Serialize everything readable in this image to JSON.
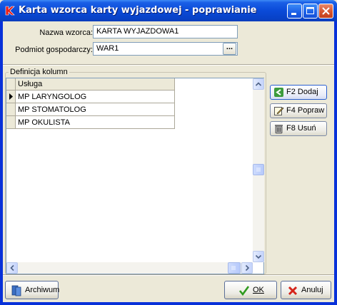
{
  "window": {
    "title": "Karta wzorca karty wyjazdowej - poprawianie"
  },
  "form": {
    "template_name_label": "Nazwa wzorca:",
    "template_name_value": "KARTA WYJAZDOWA1",
    "entity_label": "Podmiot gospodarczy:",
    "entity_value": "WAR1",
    "entity_lookup_label": "..."
  },
  "columns_section": {
    "legend": "Definicja kolumn",
    "header": "Usługa",
    "rows": [
      "MP LARYNGOLOG",
      "MP STOMATOLOG",
      "MP OKULISTA"
    ],
    "current_row_marker": "▶"
  },
  "side_buttons": {
    "add": "F2 Dodaj",
    "edit": "F4 Popraw",
    "delete": "F8 Usuń"
  },
  "footer": {
    "archive": "Archiwum",
    "ok": "OK",
    "cancel": "Anuluj"
  }
}
